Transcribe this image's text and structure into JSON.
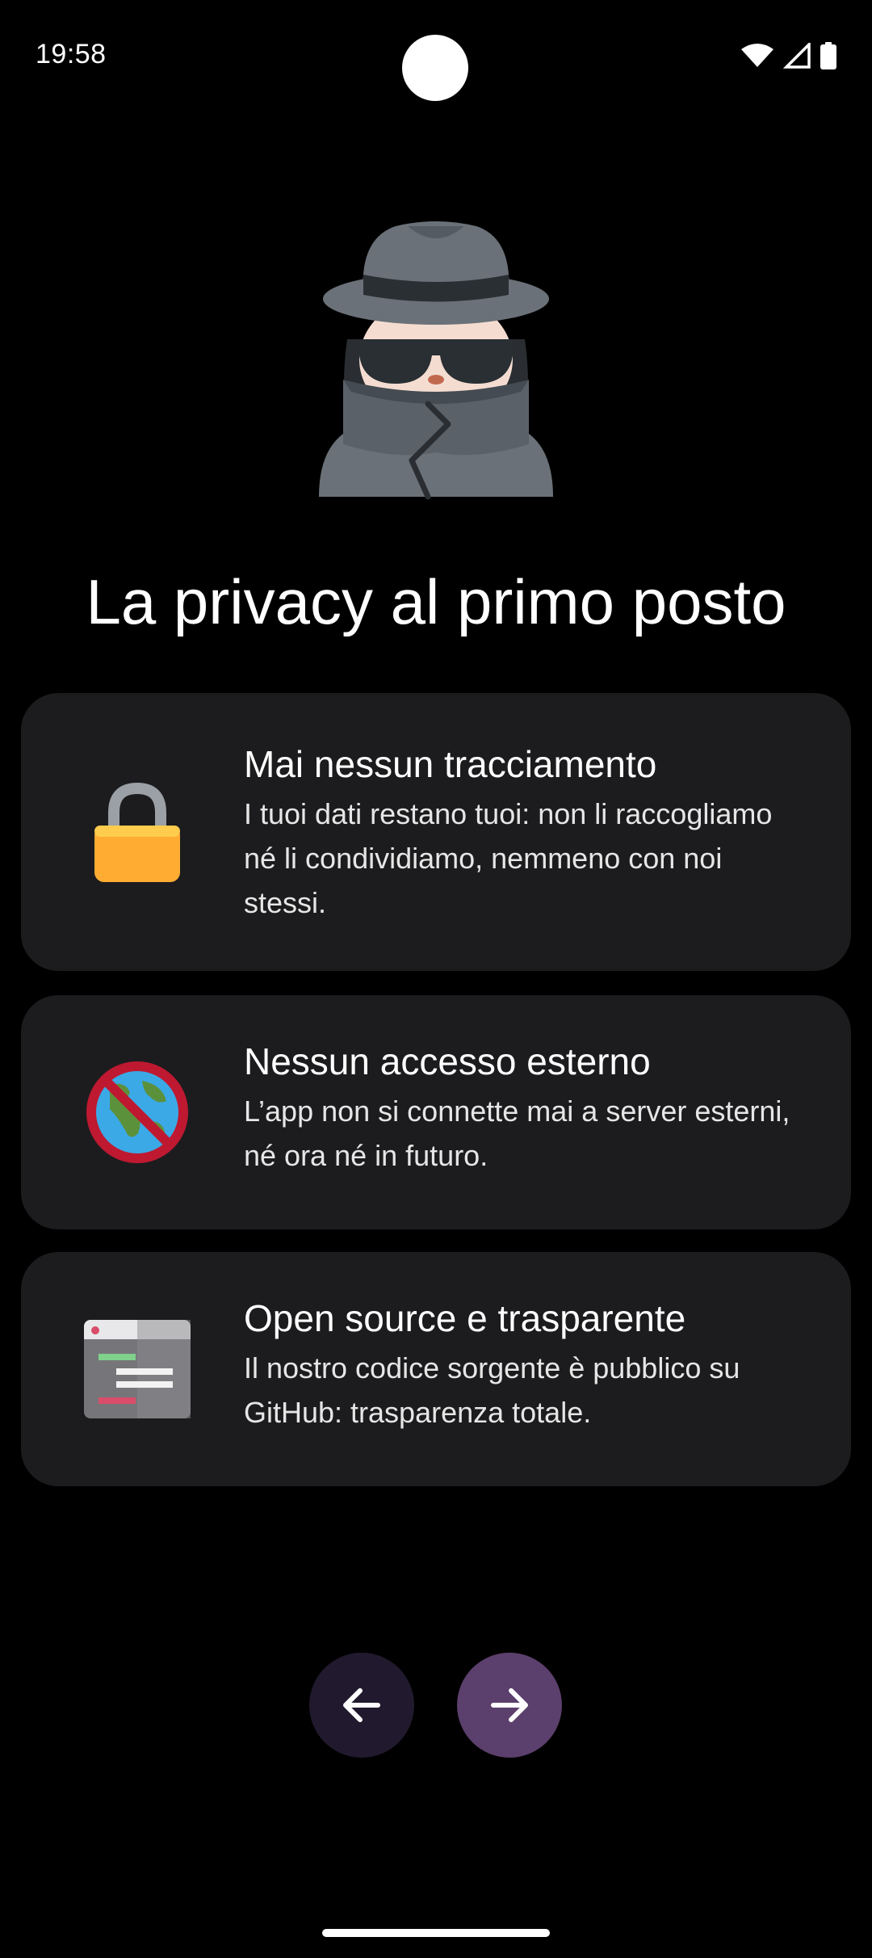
{
  "status_bar": {
    "time": "19:58",
    "icons": [
      "wifi-icon",
      "cellular-signal-icon",
      "battery-icon"
    ]
  },
  "hero": {
    "icon": "detective-spy-emoji"
  },
  "title": "La privacy al primo posto",
  "cards": [
    {
      "icon": "lock-icon",
      "title": "Mai nessun tracciamento",
      "description": "I tuoi dati restano tuoi: non li raccogliamo né li condividiamo, nemmeno con noi stessi."
    },
    {
      "icon": "no-globe-icon",
      "title": "Nessun accesso esterno",
      "description": "L’app non si connette mai a server esterni, né ora né in futuro."
    },
    {
      "icon": "source-code-window-icon",
      "title": "Open source e trasparente",
      "description": "Il nostro codice sorgente è pubblico su GitHub: trasparenza totale."
    }
  ],
  "navigation": {
    "back_icon": "arrow-left-icon",
    "next_icon": "arrow-right-icon"
  },
  "colors": {
    "background": "#000000",
    "card_background": "#1c1c1e",
    "back_button": "#211a2e",
    "next_button": "#5b3f6c"
  }
}
